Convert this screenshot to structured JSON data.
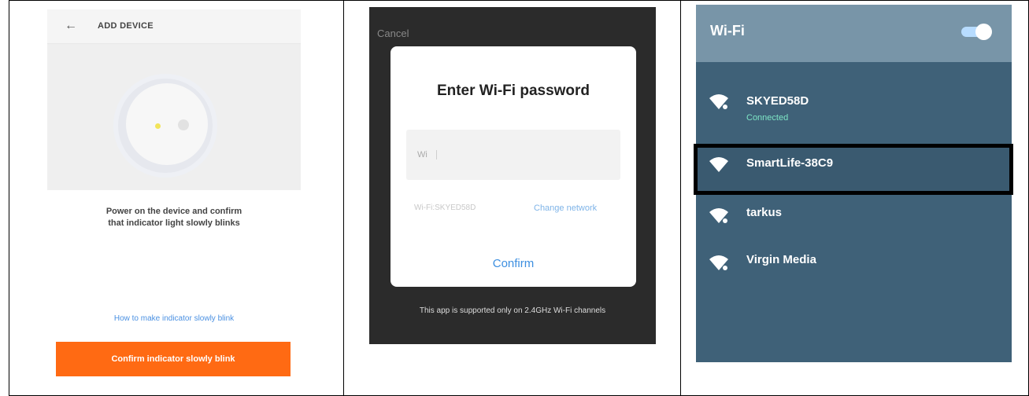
{
  "panel1": {
    "header": {
      "title": "ADD DEVICE"
    },
    "instruction_line1": "Power on the device and confirm",
    "instruction_line2": "that indicator light slowly blinks",
    "help_link": "How to make indicator slowly blink",
    "confirm_button": "Confirm indicator slowly blink",
    "accent_color": "#ff6a13"
  },
  "panel2": {
    "cancel": "Cancel",
    "dialog_title": "Enter Wi-Fi password",
    "password_placeholder": "",
    "network_name": "Wi-Fi:SKYED58D",
    "change_network": "Change network",
    "confirm": "Confirm",
    "note": "This app is supported only on 2.4GHz Wi-Fi channels"
  },
  "panel3": {
    "title": "Wi-Fi",
    "wifi_enabled": true,
    "networks": [
      {
        "name": "SKYED58D",
        "status": "Connected",
        "icon": "wifi-secured-icon"
      },
      {
        "name": "SmartLife-38C9",
        "status": "",
        "icon": "wifi-open-icon",
        "highlighted": true
      },
      {
        "name": "tarkus",
        "status": "",
        "icon": "wifi-secured-icon"
      },
      {
        "name": "Virgin Media",
        "status": "",
        "icon": "wifi-secured-icon"
      }
    ],
    "accent_color": "#3f6178"
  }
}
